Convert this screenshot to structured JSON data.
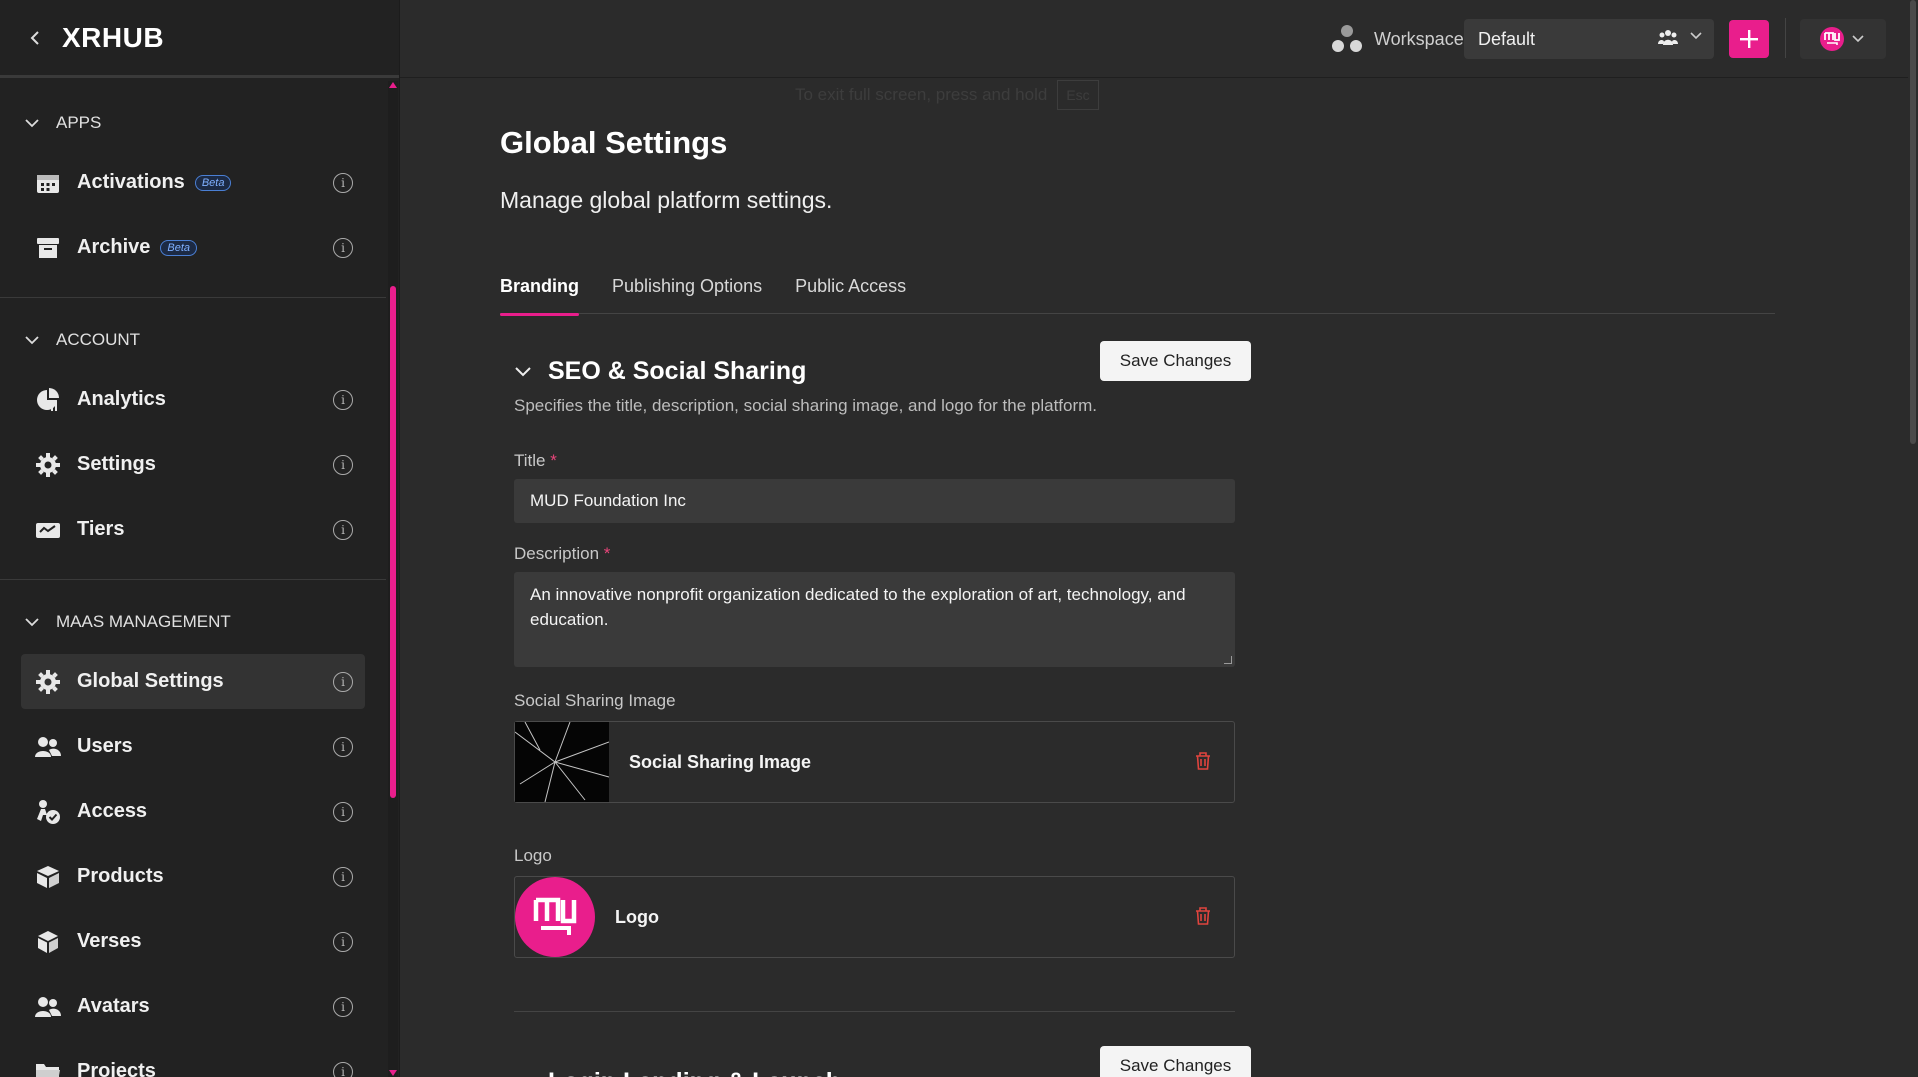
{
  "app": {
    "brand": "XRHUB"
  },
  "sidebar": {
    "sections": [
      {
        "title": "APPS",
        "items": [
          {
            "label": "Activations",
            "badge": "Beta",
            "icon": "calendar-icon"
          },
          {
            "label": "Archive",
            "badge": "Beta",
            "icon": "archive-box-icon"
          }
        ]
      },
      {
        "title": "ACCOUNT",
        "items": [
          {
            "label": "Analytics",
            "icon": "chart-pie-icon"
          },
          {
            "label": "Settings",
            "icon": "gear-icon"
          },
          {
            "label": "Tiers",
            "icon": "ticket-icon"
          }
        ]
      },
      {
        "title": "MAAS MANAGEMENT",
        "items": [
          {
            "label": "Global Settings",
            "icon": "gear-icon",
            "active": true
          },
          {
            "label": "Users",
            "icon": "users-icon"
          },
          {
            "label": "Access",
            "icon": "access-icon"
          },
          {
            "label": "Products",
            "icon": "boxes-icon"
          },
          {
            "label": "Verses",
            "icon": "cube-icon"
          },
          {
            "label": "Avatars",
            "icon": "users-icon"
          },
          {
            "label": "Projects",
            "icon": "folder-icon"
          }
        ]
      }
    ]
  },
  "topbar": {
    "workspace_label": "Workspace",
    "workspace_value": "Default",
    "fullscreen_hint": "To exit full screen, press and hold",
    "fullscreen_key": "Esc"
  },
  "main": {
    "title": "Global Settings",
    "subtitle": "Manage global platform settings.",
    "tabs": [
      {
        "label": "Branding",
        "active": true
      },
      {
        "label": "Publishing Options"
      },
      {
        "label": "Public Access"
      }
    ],
    "seo": {
      "title": "SEO & Social Sharing",
      "save_label": "Save Changes",
      "description": "Specifies the title, description, social sharing image, and logo for the platform.",
      "title_label": "Title",
      "title_value": "MUD Foundation Inc",
      "description_label": "Description",
      "description_value": "An innovative nonprofit organization dedicated to the exploration of art, technology, and education.",
      "image_label": "Social Sharing Image",
      "image_name": "Social Sharing Image",
      "logo_label": "Logo",
      "logo_name": "Logo",
      "required_mark": "*"
    },
    "next_section": {
      "title": "Login Landing & Launch",
      "save_label": "Save Changes"
    }
  },
  "colors": {
    "accent": "#e91e8c",
    "background": "#2b2b2b",
    "sidebar": "#222222",
    "danger": "#e0443e"
  }
}
